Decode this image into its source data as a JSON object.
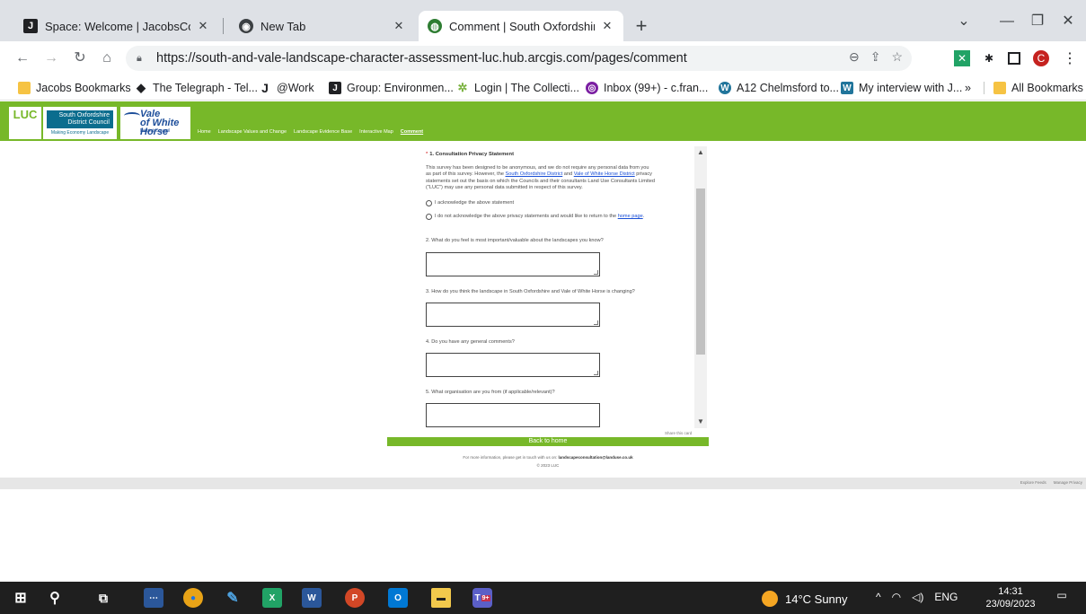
{
  "tabs": [
    {
      "title": "Space: Welcome | JacobsConnect",
      "active": false
    },
    {
      "title": "New Tab",
      "active": false
    },
    {
      "title": "Comment | South Oxfordshire an",
      "active": true
    }
  ],
  "toolbar": {
    "url": "https://south-and-vale-landscape-character-assessment-luc.hub.arcgis.com/pages/comment",
    "profile_initial": "C"
  },
  "bookmarks": [
    {
      "label": "Jacobs Bookmarks",
      "icon": "folder-icon"
    },
    {
      "label": "The Telegraph - Tel...",
      "icon": "telegraph-icon"
    },
    {
      "label": "@Work",
      "icon": "j-icon"
    },
    {
      "label": "Group: Environmen...",
      "icon": "jacobs-icon"
    },
    {
      "label": "Login | The Collecti...",
      "icon": "collective-icon"
    },
    {
      "label": "Inbox (99+) - c.fran...",
      "icon": "inbox-icon"
    },
    {
      "label": "A12 Chelmsford to...",
      "icon": "wordpress-icon"
    },
    {
      "label": "My interview with J...",
      "icon": "wordpress-icon"
    }
  ],
  "bookmarks_more": "»",
  "all_bookmarks": "All Bookmarks",
  "site": {
    "logo_luc": "LUC",
    "logo_so_line1": "South Oxfordshire",
    "logo_so_line2": "District Council",
    "logo_so_tag": "Making Economy Landscape",
    "logo_vwh_line1": "Vale",
    "logo_vwh_line2": "of White Horse",
    "logo_vwh_line3": "District Council",
    "nav": [
      "Home",
      "Landscape Values and Change",
      "Landscape Evidence Base",
      "Interactive Map",
      "Comment"
    ]
  },
  "survey": {
    "q1_required": "*",
    "q1_label": "1. Consultation Privacy Statement",
    "q1_para_a": "This survey has been designed to be anonymous, and we do not require any personal data from you as part of this survey. However, the ",
    "q1_link1": "South Oxfordshire District",
    "q1_para_b": " and ",
    "q1_link2": "Vale of White Horse District",
    "q1_para_c": " privacy statements set out the basis on which the Councils and their consultants Land Use Consultants Limited (\"LUC\") may use any personal data submitted in respect of this survey.",
    "opt1": "I acknowledge the above statement",
    "opt2_a": "I do not acknowledge the above privacy statements and would like to return to the ",
    "opt2_link": "home page",
    "opt2_b": ".",
    "q2": "2. What do you feel is most important/valuable about the landscapes you know?",
    "q3": "3. How do you think the landscape in South Oxfordshire and Vale of White Horse is changing?",
    "q4": "4. Do you have any general comments?",
    "q5": "5. What organisation are you from (if applicable/relevant)?",
    "share": "Share this card"
  },
  "back_home": "Back to home",
  "footer": {
    "info_prefix": "For more information, please get in touch with us on: ",
    "email": "landscapeconsultation@landuse.co.uk",
    "copyright": "© 2023 LUC",
    "explore": "Explore Feeds",
    "privacy": "Manage Privacy"
  },
  "taskbar": {
    "weather": "14°C  Sunny",
    "lang": "ENG",
    "time": "14:31",
    "date": "23/09/2023",
    "teams_badge": "9+"
  },
  "colors": {
    "site_green": "#77b829",
    "link_blue": "#1a4fd6",
    "tabstrip": "#dee1e6"
  }
}
